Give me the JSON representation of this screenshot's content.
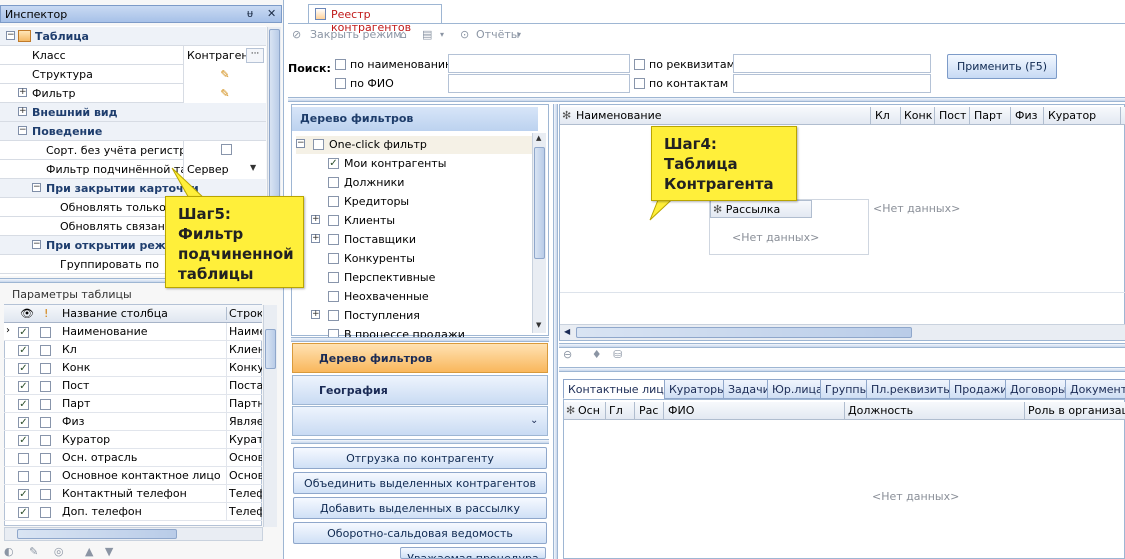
{
  "inspector": {
    "title": "Инспектор",
    "pin_icon": "ᵾ",
    "close_icon": "✕",
    "rows": [
      {
        "label": "Таблица",
        "type": "category"
      },
      {
        "label": "Класс",
        "value": "Контрагент",
        "more": "···"
      },
      {
        "label": "Структура",
        "value": "✎"
      },
      {
        "label": "Фильтр",
        "value": "✎"
      },
      {
        "label": "Внешний вид",
        "type": "category"
      },
      {
        "label": "Поведение",
        "type": "category"
      },
      {
        "label": "Сорт. без учёта регистра"
      },
      {
        "label": "Фильтр подчинённой та...",
        "value": "Сервер"
      },
      {
        "label": "При закрытии карточки",
        "type": "category"
      },
      {
        "label": "Обновлять только те"
      },
      {
        "label": "Обновлять связанны"
      },
      {
        "label": "При открытии режима",
        "type": "category"
      },
      {
        "label": "Группировать по"
      }
    ]
  },
  "params": {
    "title": "Параметры таблицы",
    "header": {
      "name": "Название столбца",
      "string": "Строка"
    },
    "rows": [
      {
        "name": "Наименование",
        "string": "Наимен",
        "c1": true,
        "c2": false
      },
      {
        "name": "Кл",
        "string": "Клиент",
        "c1": true,
        "c2": false
      },
      {
        "name": "Конк",
        "string": "Конкур",
        "c1": true,
        "c2": false
      },
      {
        "name": "Пост",
        "string": "Постав",
        "c1": true,
        "c2": false
      },
      {
        "name": "Парт",
        "string": "Партне",
        "c1": true,
        "c2": false
      },
      {
        "name": "Физ",
        "string": "Являет",
        "c1": true,
        "c2": false
      },
      {
        "name": "Куратор",
        "string": "Куратор",
        "c1": true,
        "c2": false
      },
      {
        "name": "Осн. отрасль",
        "string": "Основн",
        "c1": false,
        "c2": false
      },
      {
        "name": "Основное контактное лицо",
        "string": "Основн",
        "c1": false,
        "c2": false
      },
      {
        "name": "Контактный телефон",
        "string": "Телефо",
        "c1": true,
        "c2": false
      },
      {
        "name": "Доп. телефон",
        "string": "Телефо",
        "c1": true,
        "c2": false
      }
    ]
  },
  "callouts": {
    "step5": "Шаг5: Фильтр подчиненной таблицы",
    "step4": "Шаг4: Таблица Контрагента"
  },
  "tab": {
    "label": "Реестр контрагентов"
  },
  "toolbar": {
    "close_mode": "Закрыть режим",
    "reports": "Отчёты"
  },
  "search": {
    "label": "Поиск:",
    "by_name": "по наименованию",
    "by_fio": "по ФИО",
    "by_requisites": "по реквизитам",
    "by_contacts": "по контактам",
    "apply": "Применить (F5)"
  },
  "filter_tree": {
    "title": "Дерево фильтров",
    "items": [
      {
        "label": "One-click фильтр",
        "checked": false,
        "expander": "minus"
      },
      {
        "label": "Мои контрагенты",
        "checked": true
      },
      {
        "label": "Должники",
        "checked": false
      },
      {
        "label": "Кредиторы",
        "checked": false
      },
      {
        "label": "Клиенты",
        "checked": false,
        "expander": "plus"
      },
      {
        "label": "Поставщики",
        "checked": false,
        "expander": "plus"
      },
      {
        "label": "Конкуренты",
        "checked": false
      },
      {
        "label": "Перспективные",
        "checked": false
      },
      {
        "label": "Неохваченные",
        "checked": false
      },
      {
        "label": "Поступления",
        "checked": false,
        "expander": "plus"
      },
      {
        "label": "В процессе продажи",
        "checked": false
      }
    ]
  },
  "nav": {
    "filter_tree": "Дерево фильтров",
    "geography": "География"
  },
  "actions": [
    "Отгрузка по контрагенту",
    "Объединить выделенных контрагентов",
    "Добавить выделенных в рассылку",
    "Оборотно-сальдовая ведомость",
    "Уважаемая процедура"
  ],
  "main_grid": {
    "columns": [
      "Наименование",
      "Кл",
      "Конк",
      "Пост",
      "Парт",
      "Физ",
      "Куратор"
    ],
    "no_data": "<Нет данных>",
    "mailing_label": "Рассылка",
    "mailing_no_data": "<Нет данных>"
  },
  "bottom_tabs": [
    "Контактные лица",
    "Кураторы",
    "Задачи",
    "Юр.лица",
    "Группы",
    "Пл.реквизиты",
    "Продажи",
    "Договоры",
    "Документы"
  ],
  "bottom_grid": {
    "columns": [
      "Осн",
      "Гл",
      "Рас",
      "ФИО",
      "Должность",
      "Роль в организации"
    ],
    "no_data": "<Нет данных>"
  }
}
